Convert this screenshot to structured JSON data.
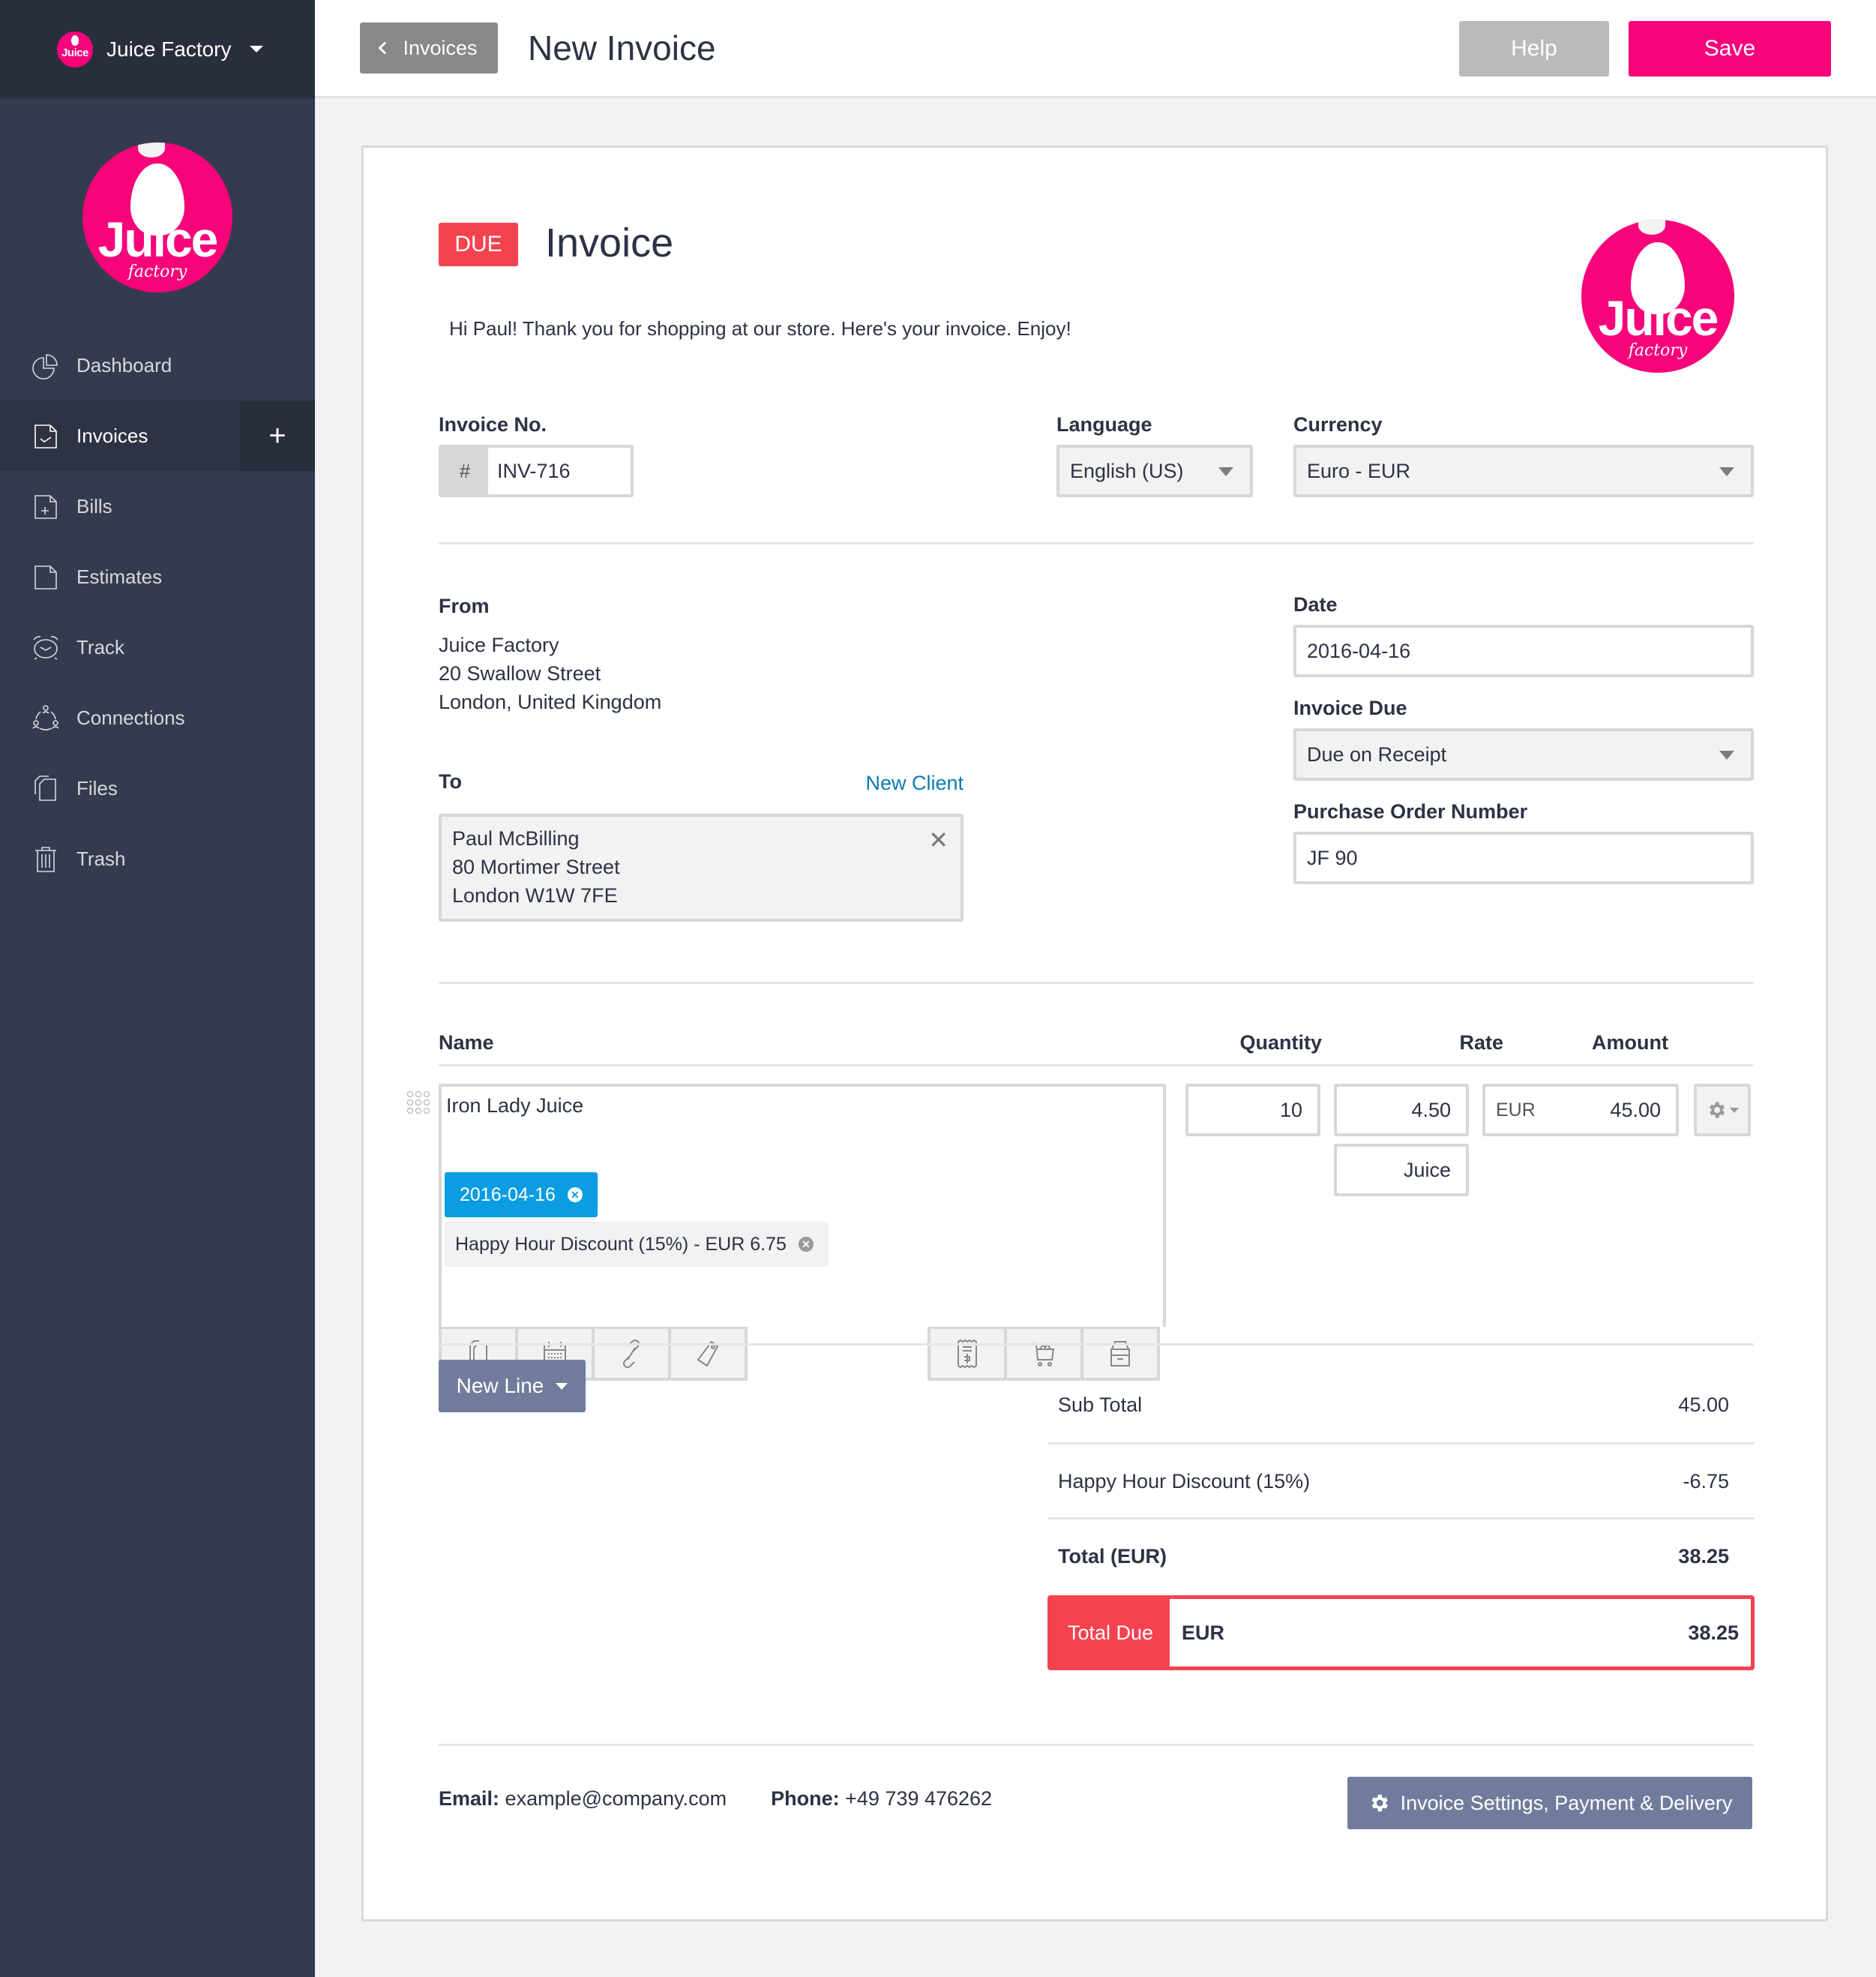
{
  "org": {
    "name": "Juice Factory",
    "logo_text": "Juice",
    "logo_subtext": "factory"
  },
  "colors": {
    "brand": "#f7037a",
    "due": "#f5424f",
    "link": "#0b7bb5",
    "tag": "#0a9de2",
    "button_secondary": "#717c9c",
    "sidebar": "#353b4e"
  },
  "sidebar": {
    "items": [
      {
        "label": "Dashboard",
        "icon": "pie-chart-icon",
        "active": false
      },
      {
        "label": "Invoices",
        "icon": "invoice-check-icon",
        "active": true,
        "action": "+"
      },
      {
        "label": "Bills",
        "icon": "bill-plus-icon",
        "active": false
      },
      {
        "label": "Estimates",
        "icon": "document-icon",
        "active": false
      },
      {
        "label": "Track",
        "icon": "alarm-clock-icon",
        "active": false
      },
      {
        "label": "Connections",
        "icon": "people-network-icon",
        "active": false
      },
      {
        "label": "Files",
        "icon": "files-icon",
        "active": false
      },
      {
        "label": "Trash",
        "icon": "trash-icon",
        "active": false
      }
    ]
  },
  "header": {
    "back_label": "Invoices",
    "title": "New Invoice",
    "help_label": "Help",
    "save_label": "Save"
  },
  "invoice": {
    "status": "DUE",
    "title": "Invoice",
    "greeting": "Hi Paul! Thank you for shopping at our store. Here's your invoice. Enjoy!",
    "number_label": "Invoice No.",
    "number_prefix": "#",
    "number": "INV-716",
    "language_label": "Language",
    "language": "English (US)",
    "currency_label": "Currency",
    "currency": "Euro - EUR",
    "from_label": "From",
    "from_lines": [
      "Juice Factory",
      "20 Swallow Street",
      "London, United Kingdom"
    ],
    "to_label": "To",
    "new_client_label": "New Client",
    "to_lines": [
      "Paul McBilling",
      "80 Mortimer Street",
      "London W1W 7FE"
    ],
    "date_label": "Date",
    "date": "2016-04-16",
    "due_label": "Invoice Due",
    "due": "Due on Receipt",
    "po_label": "Purchase Order Number",
    "po": "JF 90"
  },
  "lines": {
    "headers": {
      "name": "Name",
      "quantity": "Quantity",
      "rate": "Rate",
      "amount": "Amount"
    },
    "items": [
      {
        "name": "Iron Lady Juice",
        "date_tag": "2016-04-16",
        "discount_tag": "Happy Hour Discount (15%) - EUR 6.75",
        "quantity": "10",
        "rate": "4.50",
        "unit": "Juice",
        "amount_currency": "EUR",
        "amount": "45.00"
      }
    ],
    "tools_left": [
      "copy-icon",
      "calendar-icon",
      "link-icon",
      "tag-icon"
    ],
    "tools_right": [
      "receipt-icon",
      "cart-icon",
      "archive-icon"
    ],
    "new_line_label": "New Line"
  },
  "summary": {
    "subtotal_label": "Sub Total",
    "subtotal": "45.00",
    "discount_label": "Happy Hour Discount (15%)",
    "discount": "-6.75",
    "total_label": "Total (EUR)",
    "total": "38.25",
    "total_due_label": "Total Due",
    "total_due_currency": "EUR",
    "total_due": "38.25"
  },
  "footer": {
    "email_label": "Email:",
    "email": "example@company.com",
    "phone_label": "Phone:",
    "phone": "+49 739 476262",
    "settings_label": "Invoice Settings, Payment & Delivery"
  }
}
